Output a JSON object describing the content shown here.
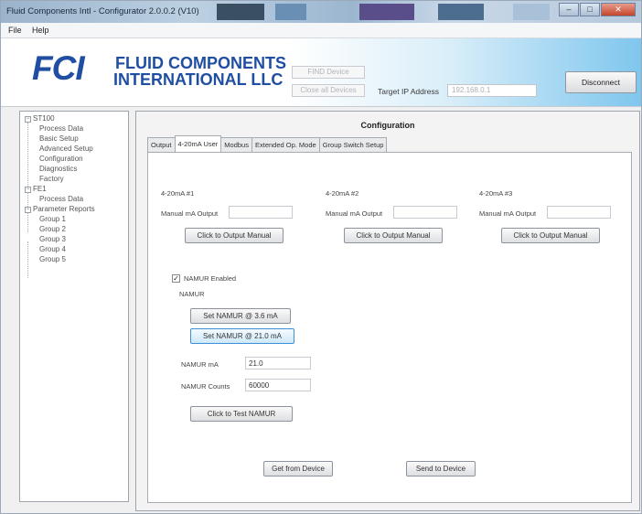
{
  "window": {
    "title": "Fluid Components Intl - Configurator 2.0.0.2 (V10)",
    "controls": {
      "minimize": "–",
      "maximize": "□",
      "close": "✕"
    }
  },
  "menu": {
    "file": "File",
    "help": "Help"
  },
  "header": {
    "logo_text": "FCI",
    "company_line1": "FLUID COMPONENTS",
    "company_line2": "INTERNATIONAL LLC",
    "btn_upper": "FIND Device",
    "btn_lower": "Close all Devices",
    "target_ip_label": "Target IP Address",
    "target_ip_value": "192.168.0.1",
    "disconnect_label": "Disconnect"
  },
  "tree": {
    "collapse_glyph": "−",
    "nodes": [
      {
        "label": "ST100",
        "level": 0
      },
      {
        "label": "Process Data",
        "level": 1
      },
      {
        "label": "Basic Setup",
        "level": 1
      },
      {
        "label": "Advanced Setup",
        "level": 1
      },
      {
        "label": "Configuration",
        "level": 1
      },
      {
        "label": "Diagnostics",
        "level": 1
      },
      {
        "label": "Factory",
        "level": 1
      },
      {
        "label": "FE1",
        "level": 0
      },
      {
        "label": "Process Data",
        "level": 1
      },
      {
        "label": "Parameter Reports",
        "level": 0
      },
      {
        "label": "Group 1",
        "level": 1
      },
      {
        "label": "Group 2",
        "level": 1
      },
      {
        "label": "Group 3",
        "level": 1
      },
      {
        "label": "Group 4",
        "level": 1
      },
      {
        "label": "Group 5",
        "level": 1
      }
    ]
  },
  "config": {
    "title": "Configuration",
    "tabs": [
      "Output",
      "4-20mA User",
      "Modbus",
      "Extended Op. Mode",
      "Group Switch Setup"
    ],
    "active_tab": "4-20mA User",
    "channels": [
      {
        "header": "4-20mA #1",
        "manual_label": "Manual mA Output",
        "button": "Click to Output Manual"
      },
      {
        "header": "4-20mA #2",
        "manual_label": "Manual mA Output",
        "button": "Click to Output Manual"
      },
      {
        "header": "4-20mA #3",
        "manual_label": "Manual mA Output",
        "button": "Click to Output Manual"
      }
    ],
    "namur": {
      "checkbox_label": "NAMUR Enabled",
      "checked_glyph": "✓",
      "group_label": "NAMUR",
      "btn_low": "Set NAMUR @ 3.6 mA",
      "btn_high": "Set NAMUR @ 21.0 mA",
      "ma_label": "NAMUR mA",
      "ma_value": "21.0",
      "counts_label": "NAMUR Counts",
      "counts_value": "60000",
      "test_button": "Click to Test NAMUR"
    },
    "get_button": "Get from Device",
    "send_button": "Send to Device"
  }
}
